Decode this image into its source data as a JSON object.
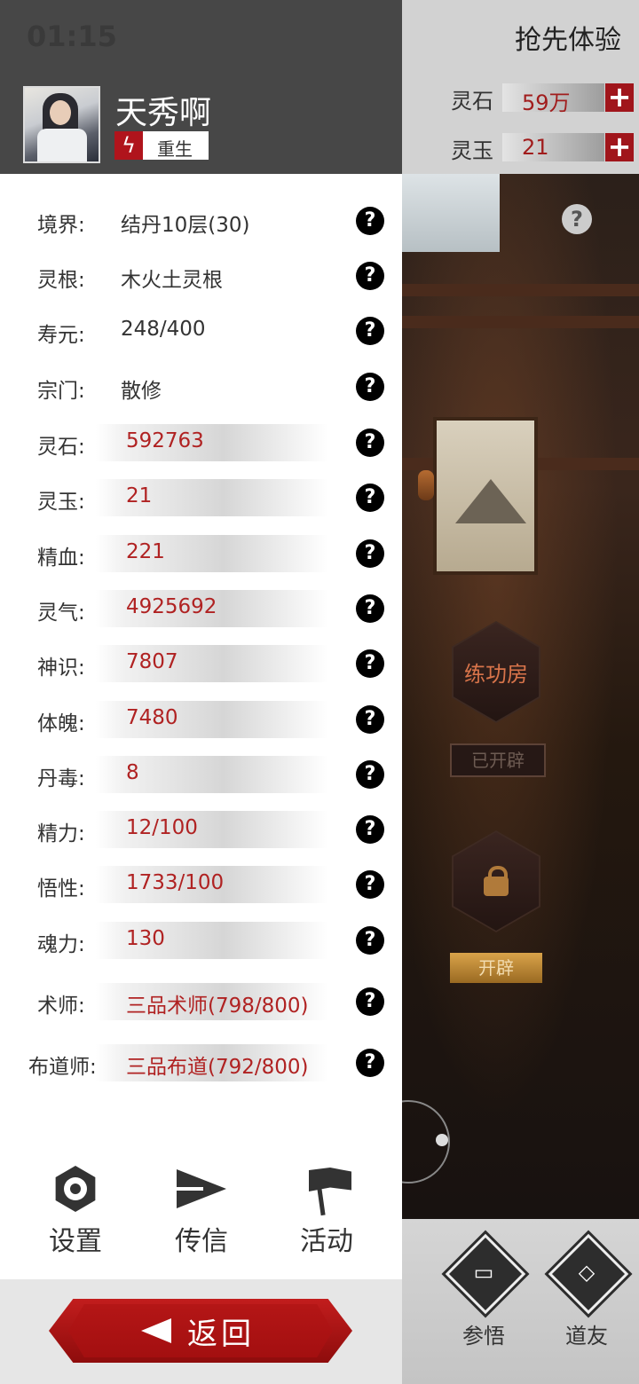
{
  "status_bar": {
    "time": "01:15"
  },
  "player": {
    "name": "天秀啊",
    "badge": "重生",
    "badge_icon": "lightning-icon"
  },
  "stats": [
    {
      "label": "境界:",
      "value": "结丹10层(30)"
    },
    {
      "label": "灵根:",
      "value": "木火土灵根"
    },
    {
      "label": "寿元:",
      "value": "248/400"
    },
    {
      "label": "宗门:",
      "value": "散修"
    },
    {
      "label": "灵石:",
      "value": "592763"
    },
    {
      "label": "灵玉:",
      "value": "21"
    },
    {
      "label": "精血:",
      "value": "221"
    },
    {
      "label": "灵气:",
      "value": "4925692"
    },
    {
      "label": "神识:",
      "value": "7807"
    },
    {
      "label": "体魄:",
      "value": "7480"
    },
    {
      "label": "丹毒:",
      "value": "8"
    },
    {
      "label": "精力:",
      "value": "12/100"
    },
    {
      "label": "悟性:",
      "value": "1733/100"
    },
    {
      "label": "魂力:",
      "value": "130"
    },
    {
      "label": "术师:",
      "value": "三品术师(798/800)"
    },
    {
      "label": "布道师:",
      "value": "三品布道(792/800)"
    }
  ],
  "help_glyph": "?",
  "bottom_menu": {
    "settings": "设置",
    "message": "传信",
    "activity": "活动"
  },
  "back_label": "返回",
  "game": {
    "title": "抢先体验",
    "resources": [
      {
        "label": "灵石",
        "value": "59万",
        "plus": "+"
      },
      {
        "label": "灵玉",
        "value": "21",
        "plus": "+"
      }
    ],
    "scene_help": "?",
    "room": {
      "name": "练功房",
      "status": "已开辟"
    },
    "locked_room": {
      "action": "开辟"
    },
    "nav": [
      {
        "label": "参悟"
      },
      {
        "label": "道友"
      }
    ]
  },
  "colors": {
    "accent_red": "#a0151b",
    "value_red": "#b02222",
    "header_dark": "#474747"
  }
}
